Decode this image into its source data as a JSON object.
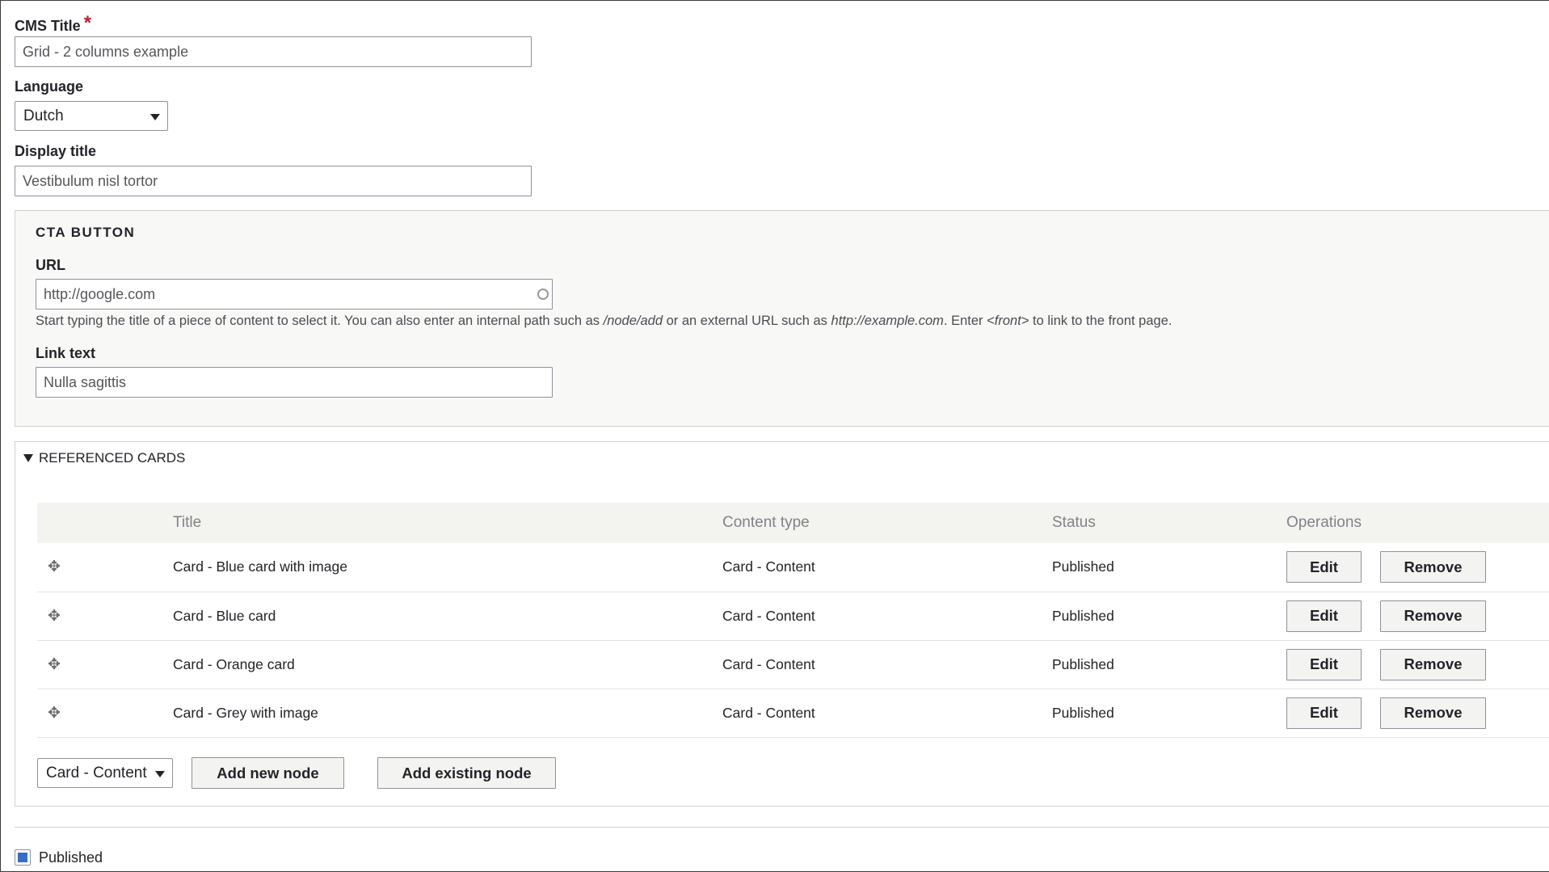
{
  "form": {
    "cms_title": {
      "label": "CMS Title",
      "required_mark": "*",
      "value": "Grid - 2 columns example"
    },
    "language": {
      "label": "Language",
      "selected": "Dutch"
    },
    "display_title": {
      "label": "Display title",
      "value": "Vestibulum nisl tortor"
    },
    "cta_button": {
      "legend": "CTA BUTTON",
      "url_label": "URL",
      "url_value": "http://google.com",
      "url_description_parts": {
        "p1": "Start typing the title of a piece of content to select it. You can also enter an internal path such as ",
        "em1": "/node/add",
        "p2": " or an external URL such as ",
        "em2": "http://example.com",
        "p3": ". Enter ",
        "em3": "<front>",
        "p4": " to link to the front page."
      },
      "link_text_label": "Link text",
      "link_text_value": "Nulla sagittis"
    },
    "referenced_cards": {
      "summary": "REFERENCED CARDS",
      "columns": [
        "Title",
        "Content type",
        "Status",
        "Operations"
      ],
      "rows": [
        {
          "title": "Card - Blue card with image",
          "content_type": "Card - Content",
          "status": "Published"
        },
        {
          "title": "Card - Blue card",
          "content_type": "Card - Content",
          "status": "Published"
        },
        {
          "title": "Card - Orange card",
          "content_type": "Card - Content",
          "status": "Published"
        },
        {
          "title": "Card - Grey with image",
          "content_type": "Card - Content",
          "status": "Published"
        }
      ],
      "edit_label": "Edit",
      "remove_label": "Remove",
      "bundle_selected": "Card - Content",
      "add_new_label": "Add new node",
      "add_existing_label": "Add existing node"
    },
    "published": {
      "label": "Published",
      "checked": true
    }
  },
  "colors": {
    "required": "#b7222e",
    "checkbox_fill": "#3a6dc2",
    "fieldset_bg": "#f8f8f6",
    "table_header_bg": "#f3f3f0"
  },
  "icons": {
    "drag_handle": "drag-handle-icon",
    "dropdown": "chevron-down-icon",
    "autocomplete": "autocomplete-throbber-icon",
    "collapse": "triangle-down-icon"
  }
}
